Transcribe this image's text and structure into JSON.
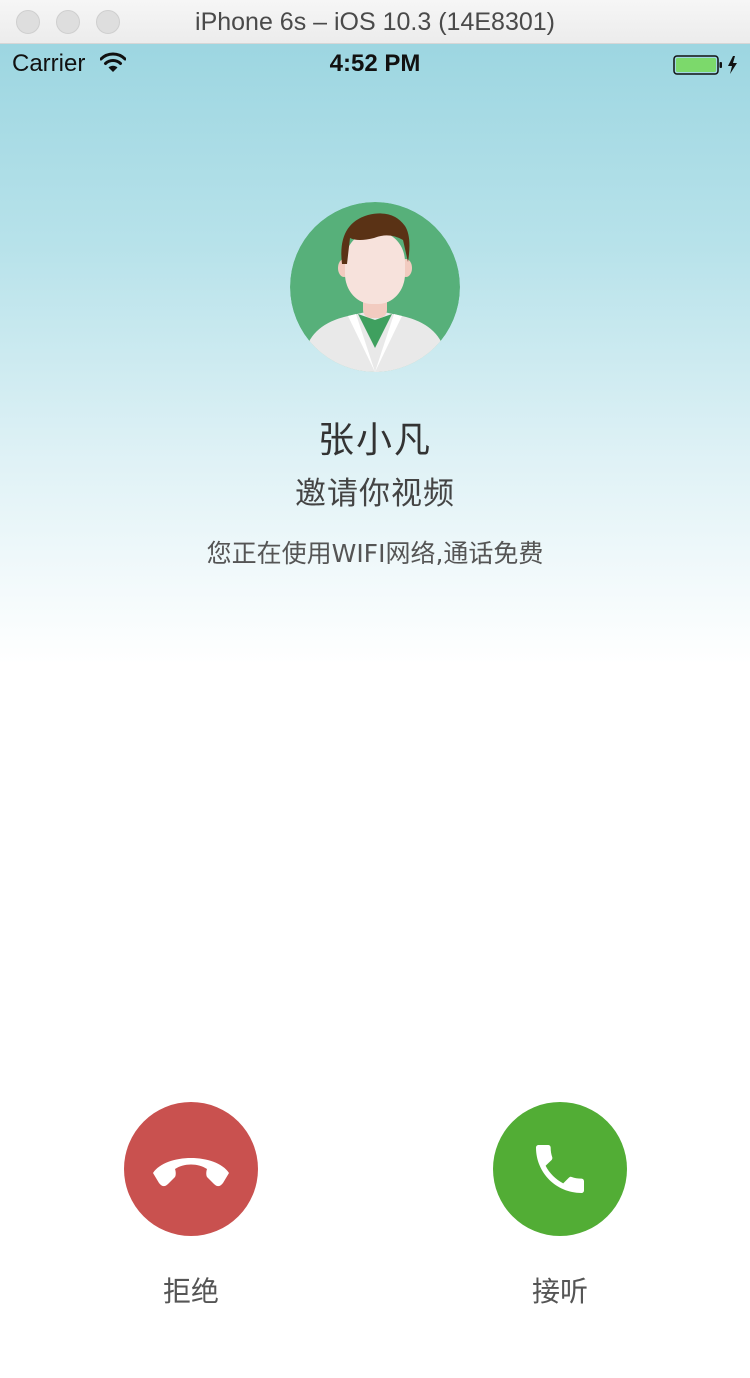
{
  "window": {
    "title": "iPhone 6s – iOS 10.3 (14E8301)"
  },
  "status_bar": {
    "carrier": "Carrier",
    "time": "4:52 PM",
    "battery_color": "#7cd96b"
  },
  "caller": {
    "name": "张小凡",
    "action": "邀请你视频",
    "network_note": "您正在使用WIFI网络,通话免费"
  },
  "actions": {
    "decline_label": "拒绝",
    "accept_label": "接听",
    "decline_color": "#c9514f",
    "accept_color": "#52ad35"
  }
}
